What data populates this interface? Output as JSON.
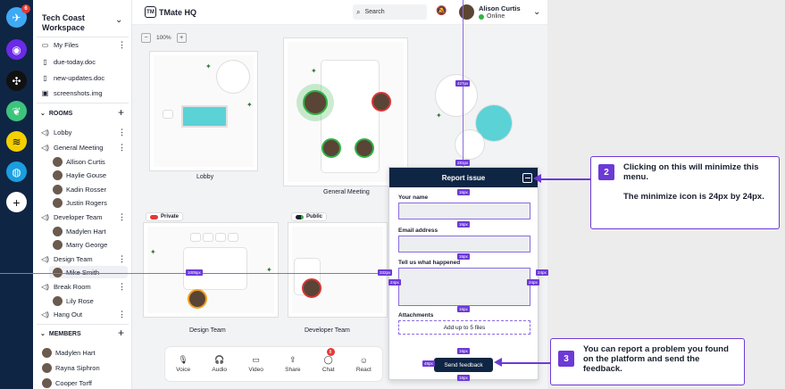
{
  "rail": {
    "badge": "6",
    "add_label": "+"
  },
  "sidebar": {
    "workspace_name": "Tech Coast Workspace",
    "files": [
      {
        "label": "My Files"
      },
      {
        "label": "due-today.doc"
      },
      {
        "label": "new-updates.doc"
      },
      {
        "label": "screenshots.img"
      }
    ],
    "rooms_header": "ROOMS",
    "rooms": [
      {
        "label": "Lobby",
        "members": []
      },
      {
        "label": "General Meeting",
        "members": [
          "Allison Curtis",
          "Haylie Gouse",
          "Kadin Rosser",
          "Justin Rogers"
        ]
      },
      {
        "label": "Developer Team",
        "members": [
          "Madylen Hart",
          "Marry George"
        ]
      },
      {
        "label": "Design Team",
        "members": [
          "Mike Smith"
        ]
      },
      {
        "label": "Break Room",
        "members": [
          "Lily Rose"
        ]
      },
      {
        "label": "Hang Out",
        "members": []
      }
    ],
    "members_header": "MEMBERS",
    "members": [
      "Madylen Hart",
      "Rayna Siphron",
      "Cooper Torff"
    ]
  },
  "header": {
    "title": "TMate HQ",
    "logo_text": "TM",
    "search_placeholder": "Search",
    "user_name": "Alison Curtis",
    "user_status": "Online"
  },
  "map": {
    "zoom_level": "100%",
    "rooms": {
      "lobby": "Lobby",
      "general": "General Meeting",
      "design": "Design Team",
      "developer": "Developer Team"
    },
    "tags": {
      "private": "Private",
      "public": "Public"
    }
  },
  "bottombar": {
    "items": [
      {
        "label": "Voice",
        "icon": "mic-icon"
      },
      {
        "label": "Audio",
        "icon": "headphones-icon"
      },
      {
        "label": "Video",
        "icon": "video-icon"
      },
      {
        "label": "Share",
        "icon": "share-icon"
      },
      {
        "label": "Chat",
        "icon": "chat-icon"
      },
      {
        "label": "React",
        "icon": "smile-icon"
      }
    ],
    "chat_badge": "8"
  },
  "report": {
    "title": "Report issue",
    "fields": {
      "name_label": "Your name",
      "email_label": "Email address",
      "what_label": "Tell us what happened",
      "attachments_label": "Attachments",
      "attach_button": "Add up to 5 files"
    },
    "send_label": "Send feedback"
  },
  "measures": {
    "m1": "427px",
    "m2": "281px",
    "m3": "16px",
    "m4": "16px",
    "m5": "16px",
    "m6": "16px",
    "m7": "1005px",
    "m8": "332px",
    "m9": "24px",
    "m10": "24px",
    "m11": "24px",
    "m12": "16px",
    "m13": "16px",
    "m14": "48px"
  },
  "callouts": [
    {
      "num": "2",
      "line1": "Clicking on this will minimize this menu.",
      "line2": "The minimize icon is 24px by 24px."
    },
    {
      "num": "3",
      "line1": "You can report a problem you found on the platform and send the feedback."
    }
  ],
  "colors": {
    "navy": "#0f2544",
    "accent": "#6c3ad6",
    "online": "#2fb344"
  }
}
